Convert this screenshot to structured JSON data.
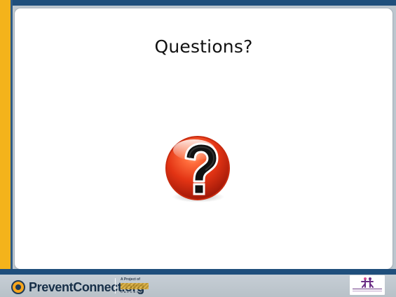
{
  "slide": {
    "title": "Questions?"
  },
  "footer": {
    "logo_text": "PreventConnect.org",
    "project_label": "A Project of",
    "calcasa_label": "CALCASA",
    "right_logo_label": "TRANSFORMING COMMUNITIES"
  },
  "colors": {
    "frame": "#1f4f7c",
    "accent": "#f4b31b",
    "panel": "#ffffff",
    "icon_red": "#d92f12"
  },
  "icons": {
    "center": "question-mark-icon",
    "prevent_connect": "prevent-connect-logo",
    "calcasa": "calcasa-logo",
    "transforming_communities": "transforming-communities-logo"
  }
}
